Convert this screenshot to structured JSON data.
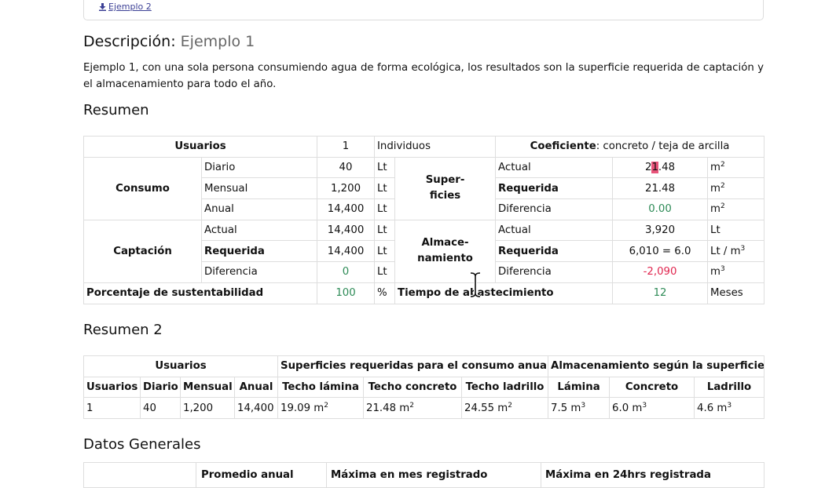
{
  "download_link": "Ejemplo 2",
  "description": {
    "label": "Descripción:",
    "name": "Ejemplo 1",
    "text": "Ejemplo 1, con una sola persona consumiendo agua de forma ecológica, los resultados son la superficie requerida de captación y el almacenamiento para todo el año."
  },
  "summary": {
    "title": "Resumen",
    "users_label": "Usuarios",
    "users_value": "1",
    "users_unit": "Individuos",
    "coef_label": "Coeficiente",
    "coef_value": ": concreto / teja de arcilla",
    "consumo_label": "Consumo",
    "consumo_rows": [
      {
        "label": "Diario",
        "value": "40",
        "unit": "Lt"
      },
      {
        "label": "Mensual",
        "value": "1,200",
        "unit": "Lt"
      },
      {
        "label": "Anual",
        "value": "14,400",
        "unit": "Lt"
      }
    ],
    "superficies_label": "Super-\nficies",
    "superficies_rows": [
      {
        "label": "Actual",
        "value_a": "2",
        "value_hl": "1",
        "value_b": ".48",
        "unit": "m"
      },
      {
        "label": "Requerida",
        "value": "21.48",
        "unit": "m"
      },
      {
        "label": "Diferencia",
        "value": "0.00",
        "unit": "m"
      }
    ],
    "captacion_label": "Captación",
    "captacion_rows": [
      {
        "label": "Actual",
        "value": "14,400",
        "unit": "Lt"
      },
      {
        "label": "Requerida",
        "value": "14,400",
        "unit": "Lt"
      },
      {
        "label": "Diferencia",
        "value": "0",
        "unit": "Lt"
      }
    ],
    "almacenamiento_label": "Almace-\nnamiento",
    "almacenamiento_rows": [
      {
        "label": "Actual",
        "value": "3,920",
        "unit": "Lt"
      },
      {
        "label": "Requerida",
        "value": "6,010 = 6.0",
        "unit": "Lt / m"
      },
      {
        "label": "Diferencia",
        "value": "-2,090",
        "unit": "m"
      }
    ],
    "sustent_label": "Porcentaje de sustentabilidad",
    "sustent_value": "100",
    "sustent_unit": "%",
    "tiempo_label": "Tiempo de abastecimiento",
    "tiempo_value": "12",
    "tiempo_unit": "Meses"
  },
  "summary2": {
    "title": "Resumen 2",
    "group_headers": [
      "Usuarios",
      "Superficies requeridas para el consumo anual",
      "Almacenamiento según la superficie"
    ],
    "headers": [
      "Usuarios",
      "Diario",
      "Mensual",
      "Anual",
      "Techo lámina",
      "Techo concreto",
      "Techo ladrillo",
      "Lámina",
      "Concreto",
      "Ladrillo"
    ],
    "row": [
      "1",
      "40",
      "1,200",
      "14,400",
      "19.09 m",
      "21.48 m",
      "24.55 m",
      "7.5 m",
      "6.0 m",
      "4.6 m"
    ]
  },
  "general": {
    "title": "Datos Generales",
    "headers": [
      "",
      "Promedio anual",
      "Máxima en mes registrado",
      "Máxima en 24hrs registrada"
    ]
  }
}
